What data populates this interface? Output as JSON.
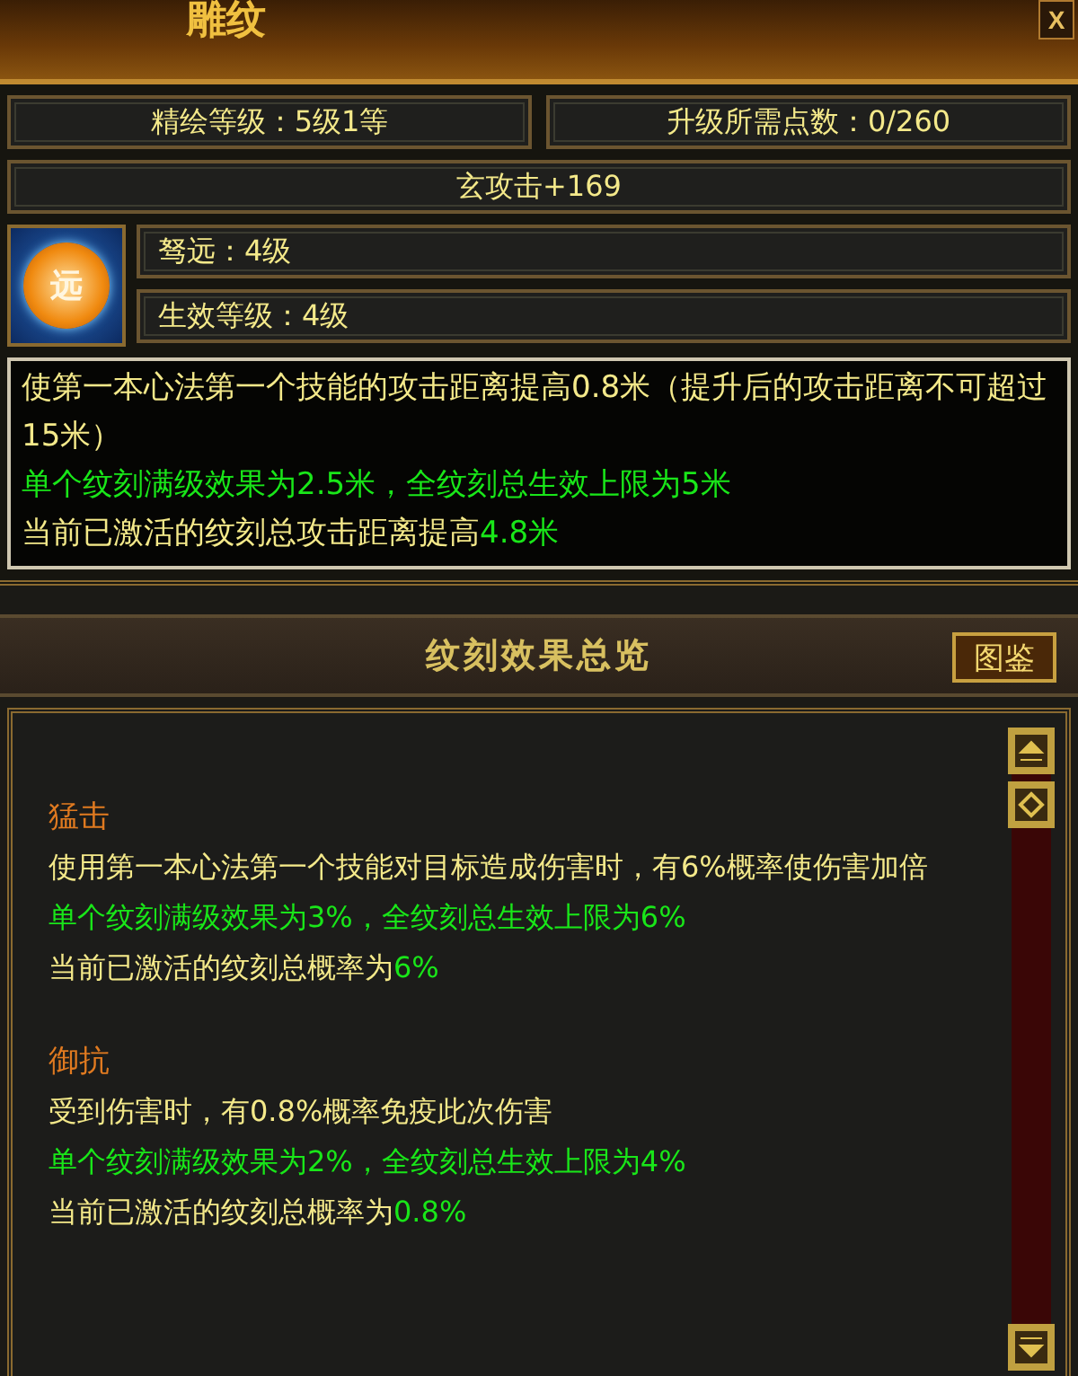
{
  "window": {
    "title": "雕纹",
    "close": "X"
  },
  "stats": [
    {
      "label": "精绘等级：5级1等"
    },
    {
      "label": "升级所需点数：0/260"
    }
  ],
  "bonus": "玄攻击+169",
  "skill": {
    "icon_glyph": "远",
    "name": "驽远：4级",
    "effective_level": "生效等级：4级"
  },
  "description": [
    {
      "segments": [
        {
          "text": "使第一本心法第一个技能的攻击距离提高0.8米（提升后的攻击距离不可超过15米）",
          "kind": "normal"
        }
      ]
    },
    {
      "segments": [
        {
          "text": "单个纹刻满级效果为2.5米，全纹刻总生效上限为5米",
          "kind": "green"
        }
      ]
    },
    {
      "segments": [
        {
          "text": "当前已激活的纹刻总攻击距离提高",
          "kind": "normal"
        },
        {
          "text": "4.8米",
          "kind": "green"
        }
      ]
    }
  ],
  "overview": {
    "title": "纹刻效果总览",
    "button": "图鉴",
    "entries": [
      {
        "name": "猛击",
        "lines": [
          {
            "segments": [
              {
                "text": "使用第一本心法第一个技能对目标造成伤害时，有6%概率使伤害加倍",
                "kind": "normal"
              }
            ]
          },
          {
            "segments": [
              {
                "text": "单个纹刻满级效果为3%，全纹刻总生效上限为6%",
                "kind": "green"
              }
            ]
          },
          {
            "segments": [
              {
                "text": "当前已激活的纹刻总概率为",
                "kind": "normal"
              },
              {
                "text": "6%",
                "kind": "green"
              }
            ]
          }
        ]
      },
      {
        "name": "御抗",
        "lines": [
          {
            "segments": [
              {
                "text": "受到伤害时，有0.8%概率免疫此次伤害",
                "kind": "normal"
              }
            ]
          },
          {
            "segments": [
              {
                "text": "单个纹刻满级效果为2%，全纹刻总生效上限为4%",
                "kind": "green"
              }
            ]
          },
          {
            "segments": [
              {
                "text": "当前已激活的纹刻总概率为",
                "kind": "normal"
              },
              {
                "text": "0.8%",
                "kind": "green"
              }
            ]
          }
        ]
      }
    ]
  }
}
